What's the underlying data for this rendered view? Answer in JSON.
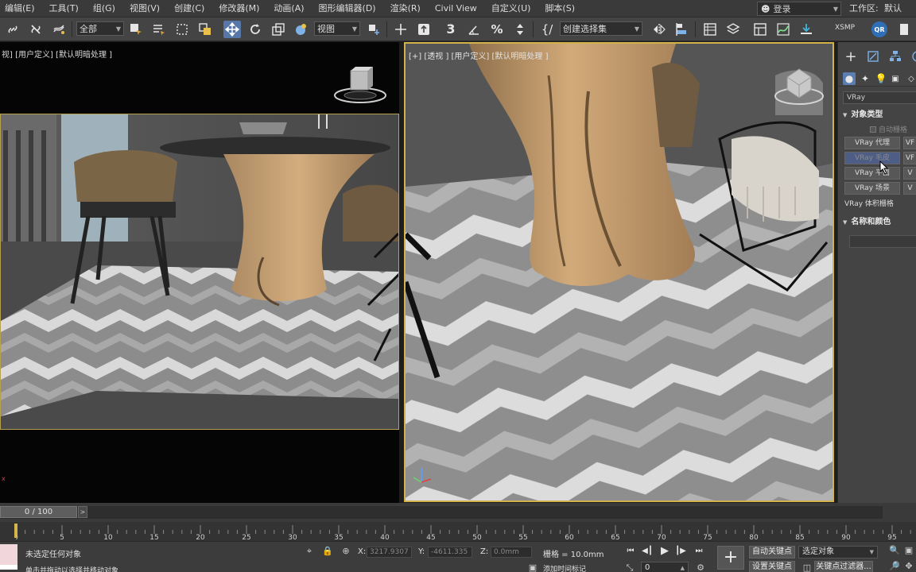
{
  "menu": [
    "编辑(E)",
    "工具(T)",
    "组(G)",
    "视图(V)",
    "创建(C)",
    "修改器(M)",
    "动画(A)",
    "图形编辑器(D)",
    "渲染(R)",
    "Civil View",
    "自定义(U)",
    "脚本(S)"
  ],
  "login": {
    "label": "登录",
    "user_icon": "user-icon"
  },
  "workspace": {
    "label": "工作区:",
    "value": "默认"
  },
  "toolbar": {
    "filter_value": "全部",
    "refcoord_value": "视图",
    "selection_set_placeholder": "创建选择集",
    "xsmp_label": "XSMP",
    "qr_label": "QR",
    "icons": [
      "link-icon",
      "unlink-icon",
      "bind-spacewarp-icon",
      "select-object-icon",
      "select-by-name-icon",
      "rect-region-icon",
      "window-crossing-icon",
      "move-icon",
      "rotate-icon",
      "scale-icon",
      "place-icon",
      "pivot-icon",
      "snap-3d-icon",
      "angle-snap-icon",
      "percent-snap-icon",
      "spinner-snap-icon",
      "edit-named-sets-icon",
      "mirror-icon",
      "align-icon",
      "scene-explorer-icon",
      "layer-explorer-icon",
      "toggle-ribbon-icon",
      "curve-editor-icon",
      "render-setup-icon"
    ]
  },
  "viewports": {
    "left_label": "视] [用户定义] [默认明暗处理 ]",
    "right_label": "[+] [透视 ] [用户定义] [默认明暗处理 ]"
  },
  "command_panel": {
    "category_dropdown": "VRay",
    "object_type_title": "对象类型",
    "autogrid_label": "自动栅格",
    "buttons": [
      "VRay 代理",
      "VRay 毛皮",
      "VRay 平面",
      "VRay 场景",
      "V"
    ],
    "buttons_right": [
      "VF",
      "VF",
      "V",
      "V"
    ],
    "volume_grid_label": "VRay 体积栅格",
    "name_color_title": "名称和颜色"
  },
  "timeslider": {
    "position": "0 / 100",
    "frame_current": 0,
    "frame_total": 100
  },
  "timeline": {
    "ticks": [
      0,
      5,
      10,
      15,
      20,
      25,
      30,
      35,
      40,
      45,
      50,
      55,
      60,
      65,
      70,
      75,
      80,
      85,
      90,
      95
    ]
  },
  "status": {
    "selection_text": "未选定任何对象",
    "prompt_text": "单击并拖动以选择并移动对象",
    "x_label": "X:",
    "x_value": "3217.9307",
    "y_label": "Y:",
    "y_value": "-4611.335",
    "z_label": "Z:",
    "z_value": "0.0mm",
    "grid_text": "栅格 = 10.0mm",
    "autokey_label": "自动关键点",
    "setkey_label": "设置关键点",
    "key_filter_label": "关键点过滤器...",
    "selected_object_dropdown": "选定对象",
    "frame_field": "0",
    "add_time_tag": "添加时间标记"
  }
}
